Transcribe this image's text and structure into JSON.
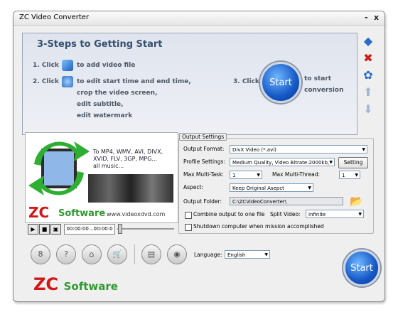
{
  "window": {
    "title": "ZC Video Converter",
    "minimize": "-",
    "close": "x"
  },
  "steps": {
    "heading": "3-Steps to Getting Start",
    "step1_prefix": "1. Click",
    "step1_text": "to add video file",
    "step2_prefix": "2. Click",
    "step2_lines": [
      "to edit start time and end time,",
      "crop the video screen,",
      "edit subtitle,",
      "edit watermark"
    ],
    "step3_prefix": "3. Click",
    "step3_button": "Start",
    "step3_text_1": "to start",
    "step3_text_2": "conversion"
  },
  "side_icons": [
    "add-video-icon",
    "delete-icon",
    "settings-icon",
    "move-up-icon",
    "move-down-icon"
  ],
  "preview": {
    "promo_lines": [
      "To MP4, WMV, AVI, DIVX,",
      "XVID, FLV, 3GP, MPG...",
      "all music..."
    ],
    "brand_zc": "ZC",
    "brand_software": "Software",
    "website": "www.videoxdvd.com"
  },
  "player": {
    "time": "00:00:00...00:00:0"
  },
  "output": {
    "legend": "Output Settings",
    "format_label": "Output Format:",
    "format_value": "DivX Video (*.avi)",
    "profile_label": "Profile Settings:",
    "profile_value": "Medium Quality, Video Bitrate:2000kb,",
    "setting_button": "Setting",
    "multitask_label": "Max Multi-Task:",
    "multitask_value": "1",
    "multithread_label": "Max Multi-Thread:",
    "multithread_value": "1",
    "aspect_label": "Aspect:",
    "aspect_value": "Keep Original Asepct",
    "folder_label": "Output Folder:",
    "folder_value": "C:\\ZCVideoConverter\\",
    "combine_label": "Combine output to one file",
    "split_label": "Split Video:",
    "split_value": "Infinite",
    "shutdown_label": "Shutdown computer when mission accomplished"
  },
  "toolbar": {
    "language_label": "Language:",
    "language_value": "English",
    "start_button": "Start"
  },
  "footer": {
    "brand_zc": "ZC",
    "brand_software": "Software"
  },
  "colors": {
    "accent_blue": "#1558c6",
    "brand_red": "#d01818",
    "brand_green": "#2f9a2f",
    "steps_text": "#35506f"
  }
}
